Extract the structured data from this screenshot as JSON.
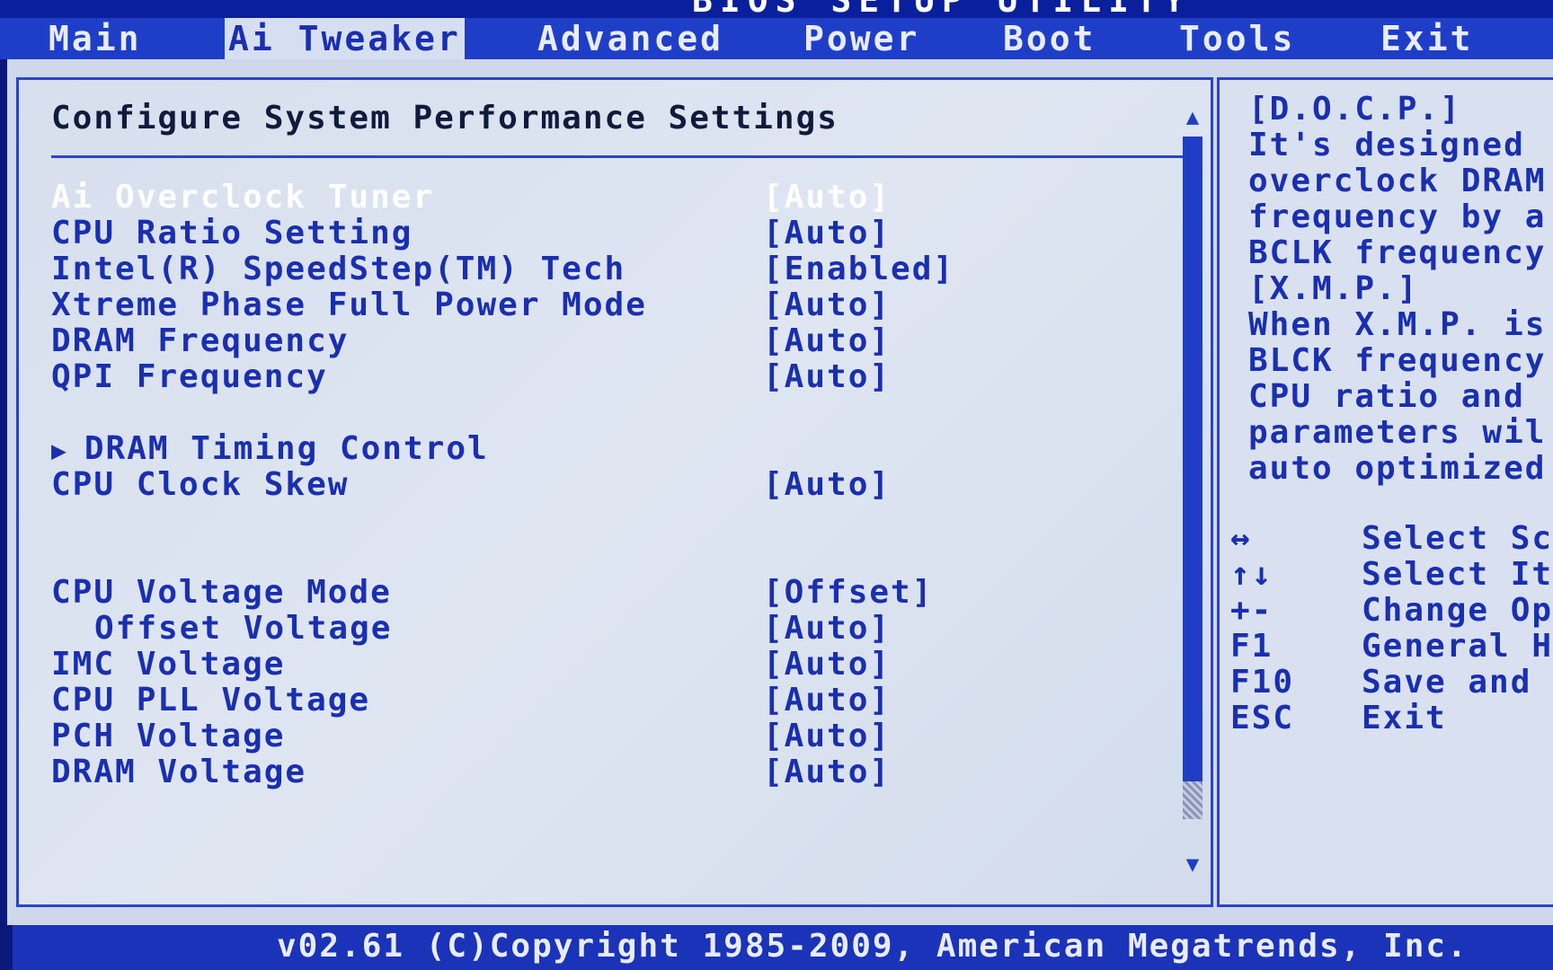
{
  "title": "BIOS SETUP UTILITY",
  "menu": [
    "Main",
    "Ai Tweaker",
    "Advanced",
    "Power",
    "Boot",
    "Tools",
    "Exit"
  ],
  "panel": {
    "heading": "Configure System Performance Settings"
  },
  "settings": [
    {
      "label": "Ai Overclock Tuner",
      "value": "[Auto]"
    },
    {
      "label": "CPU Ratio Setting",
      "value": "[Auto]"
    },
    {
      "label": "Intel(R) SpeedStep(TM) Tech",
      "value": "[Enabled]"
    },
    {
      "label": "Xtreme Phase Full Power Mode",
      "value": "[Auto]"
    },
    {
      "label": "DRAM Frequency",
      "value": "[Auto]"
    },
    {
      "label": "QPI Frequency",
      "value": "[Auto]"
    },
    {
      "label": "DRAM Timing Control",
      "value": ""
    },
    {
      "label": "CPU Clock Skew",
      "value": "[Auto]"
    },
    {
      "label": "CPU Voltage Mode",
      "value": "[Offset]"
    },
    {
      "label": "Offset Voltage",
      "value": "[Auto]"
    },
    {
      "label": "IMC Voltage",
      "value": "[Auto]"
    },
    {
      "label": "CPU PLL Voltage",
      "value": "[Auto]"
    },
    {
      "label": "PCH Voltage",
      "value": "[Auto]"
    },
    {
      "label": "DRAM Voltage",
      "value": "[Auto]"
    }
  ],
  "submenu_arrow": "▶",
  "scroll": {
    "up": "▲",
    "down": "▼"
  },
  "help": [
    "[D.O.C.P.]",
    "It's designed",
    "overclock DRAM",
    "frequency by a",
    "BCLK frequency",
    "[X.M.P.]",
    "When X.M.P. is",
    "BLCK frequency",
    "CPU ratio and",
    "parameters wil",
    "auto optimized"
  ],
  "keys": [
    {
      "key": "↔",
      "desc": "Select Sc"
    },
    {
      "key": "↑↓",
      "desc": "Select It"
    },
    {
      "key": "+-",
      "desc": "Change Op"
    },
    {
      "key": "F1",
      "desc": "General H"
    },
    {
      "key": "F10",
      "desc": "Save and"
    },
    {
      "key": "ESC",
      "desc": "Exit"
    }
  ],
  "footer": "v02.61 (C)Copyright 1985-2009, American Megatrends, Inc.",
  "colors": {
    "menu_bar": "#1f3ec8",
    "panel_bg": "#d7dfee",
    "text_blue": "#1a2fb0",
    "highlight_text": "#ffffff"
  }
}
